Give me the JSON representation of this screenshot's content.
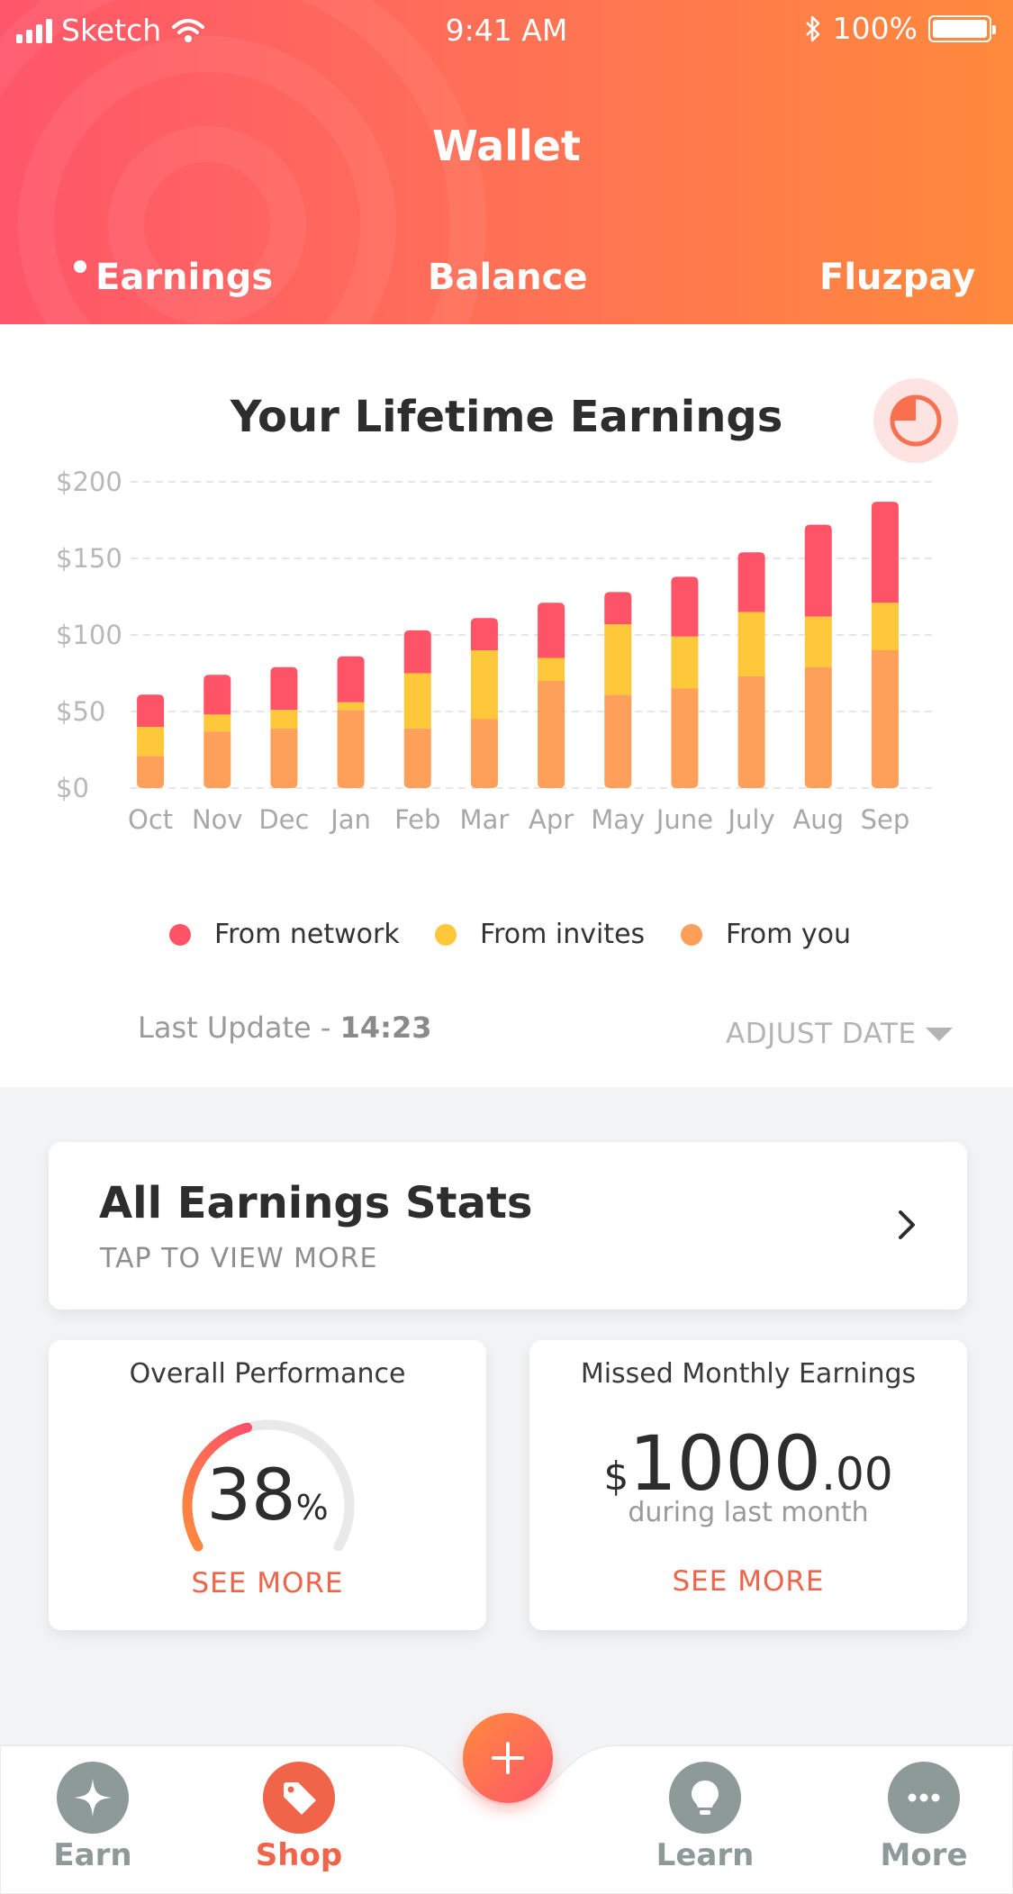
{
  "status_bar": {
    "carrier": "Sketch",
    "time": "9:41 AM",
    "battery": "100%"
  },
  "header": {
    "title": "Wallet",
    "tabs": [
      {
        "label": "Earnings",
        "active": true
      },
      {
        "label": "Balance",
        "active": false
      },
      {
        "label": "Fluzpay",
        "active": false
      }
    ]
  },
  "chart_card": {
    "title": "Your Lifetime Earnings",
    "history_icon": "clock-history-icon",
    "last_update_label": "Last Update - ",
    "last_update_time": "14:23",
    "adjust_date_label": "ADJUST DATE"
  },
  "chart_data": {
    "type": "bar",
    "stacked": true,
    "categories": [
      "Oct",
      "Nov",
      "Dec",
      "Jan",
      "Feb",
      "Mar",
      "Apr",
      "May",
      "June",
      "July",
      "Aug",
      "Sep"
    ],
    "series": [
      {
        "name": "From you",
        "color": "#FFA05A",
        "values": [
          21,
          37,
          39,
          51,
          39,
          45,
          70,
          61,
          65,
          73,
          79,
          90
        ]
      },
      {
        "name": "From invites",
        "color": "#FFC83A",
        "values": [
          19,
          11,
          12,
          5,
          36,
          45,
          15,
          46,
          34,
          42,
          33,
          31
        ]
      },
      {
        "name": "From network",
        "color": "#FF5468",
        "values": [
          21,
          26,
          28,
          30,
          28,
          21,
          36,
          21,
          39,
          39,
          60,
          66
        ]
      }
    ],
    "y_ticks": [
      "$200",
      "$150",
      "$100",
      "$50",
      "$0"
    ],
    "ylim": [
      0,
      200
    ],
    "grid": true,
    "legend_position": "bottom"
  },
  "stats_card": {
    "title": "All Earnings Stats",
    "subtitle": "TAP TO VIEW MORE"
  },
  "performance_card": {
    "title": "Overall Performance",
    "percent_value": "38",
    "percent_unit": "%",
    "progress": 0.38,
    "see_more": "SEE MORE"
  },
  "missed_card": {
    "title": "Missed Monthly Earnings",
    "currency": "$",
    "amount_int": "1000",
    "amount_dec": ".00",
    "subtitle": "during last month",
    "see_more": "SEE MORE"
  },
  "bottom_nav": {
    "items": [
      {
        "label": "Earn",
        "icon": "sparkle-icon",
        "active": false
      },
      {
        "label": "Shop",
        "icon": "tag-icon",
        "active": true
      },
      {
        "label": "Learn",
        "icon": "lightbulb-icon",
        "active": false
      },
      {
        "label": "More",
        "icon": "more-dots-icon",
        "active": false
      }
    ],
    "fab_icon": "plus-icon"
  },
  "colors": {
    "accent": "#F0644A",
    "inactive_nav": "#8E9A98",
    "header_gradient_start": "#FF566B",
    "header_gradient_end": "#FF8A3C"
  }
}
